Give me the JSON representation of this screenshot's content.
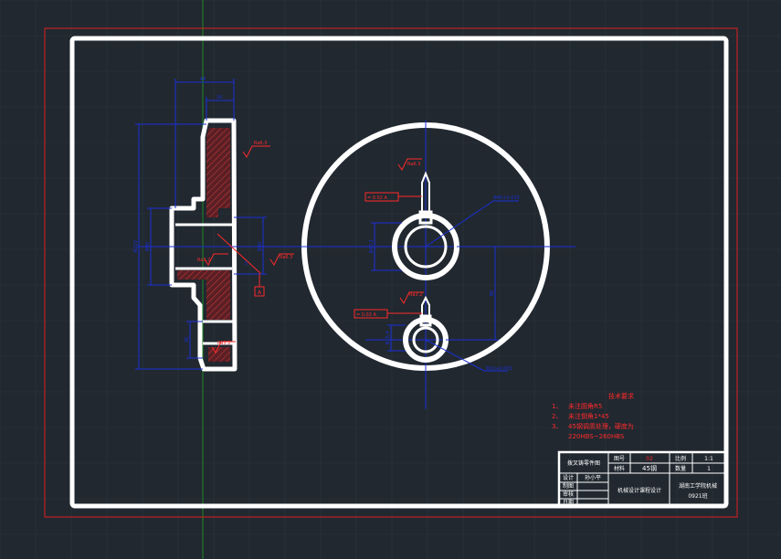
{
  "colors": {
    "background": "#212830",
    "grid": "#2c343d",
    "frame": "#ffffff",
    "outer_border": "#e02020",
    "dimension": "#1a2fd6",
    "annotation": "#ff2a2a",
    "hatch": "#b03030",
    "axis_green": "#1f8a1f"
  },
  "icons": [
    "surface-roughness-symbol",
    "datum-symbol",
    "geometric-tolerance-frame"
  ],
  "section_view": {
    "dims": {
      "width_top": "44",
      "width_hub": "24",
      "dia_outer": "Φ210",
      "dia_bore": "Φ90",
      "dia_hub": "Φ40",
      "hole_len": "36",
      "chamfer": "5",
      "datum": "A"
    },
    "roughness": [
      "Ra6.3",
      "Ra3.2",
      "Ra6.3",
      "Ra3.2"
    ]
  },
  "front_view": {
    "roughness_top": "Ra6.3",
    "tol_frame_top": "= 0.02 A",
    "bore_fit": "Φ40+0.025",
    "bore_dia": "Φ40.3",
    "center_distance": "80",
    "roughness_bottom": "Ra3.2",
    "tol_frame_bottom": "= 0.02 A",
    "small_bore_len": "Φ15.4",
    "small_bore_fit": "Φ10+0.001"
  },
  "notes": {
    "title": "技术要求",
    "items": [
      {
        "num": "1、",
        "text": "未注圆角R5"
      },
      {
        "num": "2、",
        "text": "未注倒角1*45"
      },
      {
        "num": "3、",
        "text": "45钢调质处理，硬度为"
      }
    ],
    "extra": "220HBS~260HBS"
  },
  "title_block": {
    "part_name": "拨叉铸零件图",
    "label_drawing_no": "图号",
    "drawing_no": "02",
    "label_scale": "比例",
    "scale": "1:1",
    "label_material": "材料",
    "material": "45钢",
    "label_qty": "数量",
    "qty": "1",
    "label_designer": "设计",
    "designer": "孙小平",
    "label_drawn": "制图",
    "label_checked": "审核",
    "label_date": "日期",
    "course": "机械设计课程设计",
    "school": "湖南工学院机械",
    "class_name": "0921班"
  }
}
